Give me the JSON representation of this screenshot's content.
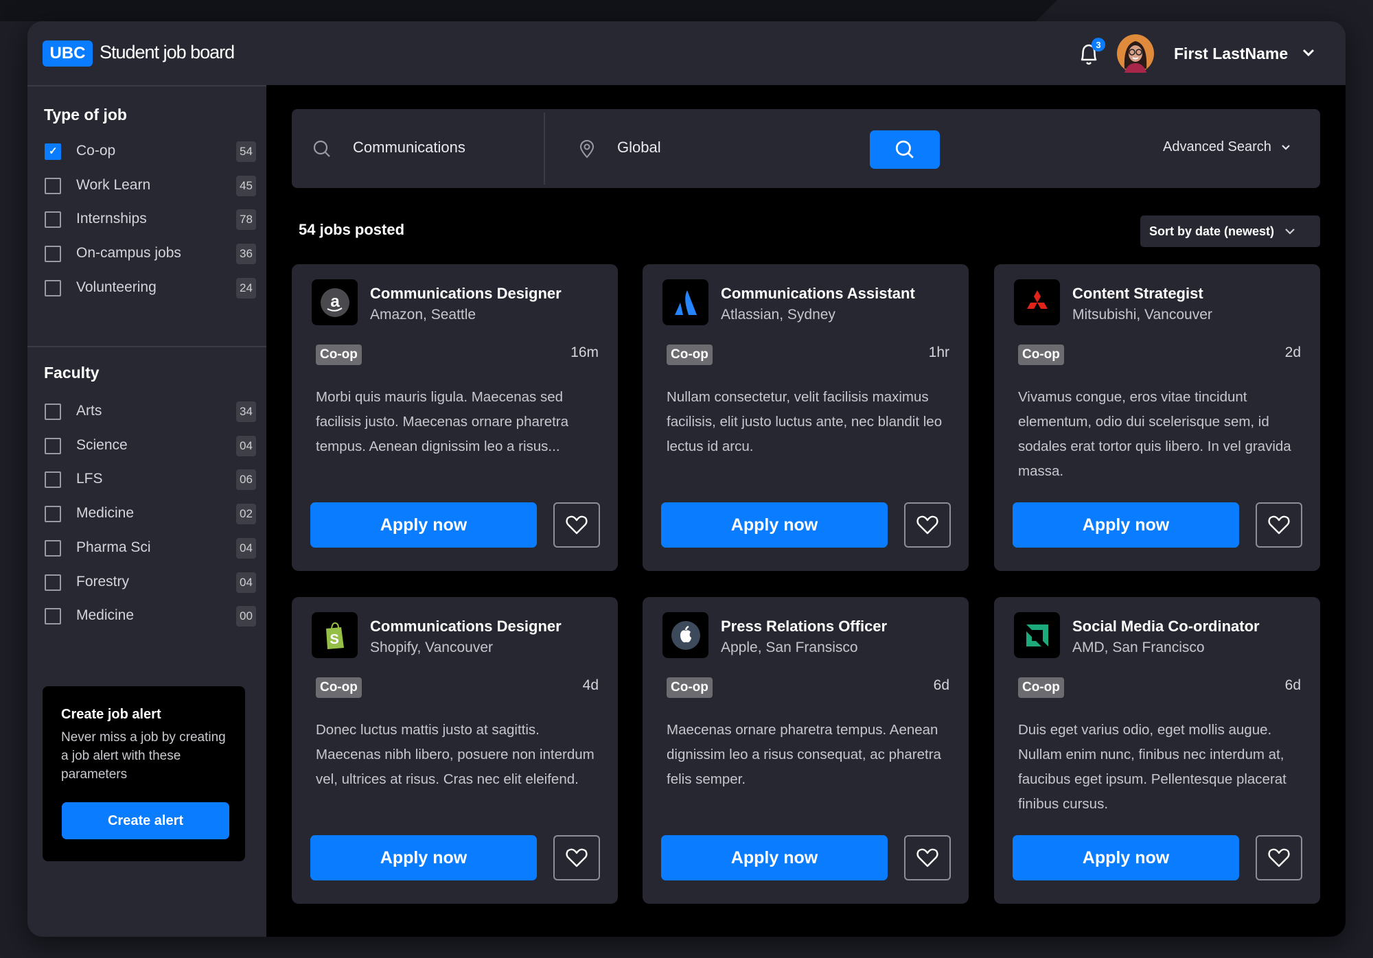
{
  "header": {
    "logo": "UBC",
    "title": "Student job board",
    "notifications": "3",
    "user_name": "First LastName"
  },
  "sidebar": {
    "type_heading": "Type of job",
    "types": [
      {
        "label": "Co-op",
        "count": "54",
        "checked": true
      },
      {
        "label": "Work Learn",
        "count": "45",
        "checked": false
      },
      {
        "label": "Internships",
        "count": "78",
        "checked": false
      },
      {
        "label": "On-campus jobs",
        "count": "36",
        "checked": false
      },
      {
        "label": "Volunteering",
        "count": "24",
        "checked": false
      }
    ],
    "faculty_heading": "Faculty",
    "faculties": [
      {
        "label": "Arts",
        "count": "34",
        "checked": false
      },
      {
        "label": "Science",
        "count": "04",
        "checked": false
      },
      {
        "label": "LFS",
        "count": "06",
        "checked": false
      },
      {
        "label": "Medicine",
        "count": "02",
        "checked": false
      },
      {
        "label": "Pharma Sci",
        "count": "04",
        "checked": false
      },
      {
        "label": "Forestry",
        "count": "04",
        "checked": false
      },
      {
        "label": "Medicine",
        "count": "00",
        "checked": false
      }
    ],
    "alert": {
      "title": "Create job alert",
      "text": "Never miss a job by creating a job alert with these parameters",
      "button": "Create alert"
    }
  },
  "search": {
    "query": "Communications",
    "location": "Global",
    "advanced": "Advanced Search"
  },
  "results": {
    "count_label": "54 jobs posted",
    "sort": "Sort by date (newest)"
  },
  "colors": {
    "accent": "#0a7cff",
    "background": "#000000",
    "panel": "#272831"
  },
  "jobs": [
    {
      "title": "Communications Designer",
      "company": "Amazon, Seattle",
      "type": "Co-op",
      "time": "16m",
      "desc": "Morbi quis mauris ligula. Maecenas sed facilisis justo. Maecenas ornare pharetra tempus. Aenean dignissim leo a risus...",
      "logo": "amazon",
      "apply": "Apply now"
    },
    {
      "title": "Communications Assistant",
      "company": "Atlassian, Sydney",
      "type": "Co-op",
      "time": "1hr",
      "desc": "Nullam consectetur, velit facilisis maximus facilisis, elit justo luctus ante, nec blandit leo lectus id arcu.",
      "logo": "atlassian",
      "apply": "Apply now"
    },
    {
      "title": "Content Strategist",
      "company": "Mitsubishi, Vancouver",
      "type": "Co-op",
      "time": "2d",
      "desc": "Vivamus congue, eros vitae tincidunt elementum, odio dui scelerisque sem, id sodales erat tortor quis libero. In vel gravida massa.",
      "logo": "mitsubishi",
      "apply": "Apply now"
    },
    {
      "title": "Communications Designer",
      "company": "Shopify, Vancouver",
      "type": "Co-op",
      "time": "4d",
      "desc": "Donec luctus mattis justo at sagittis. Maecenas nibh libero, posuere non interdum vel, ultrices at risus. Cras nec elit eleifend.",
      "logo": "shopify",
      "apply": "Apply now"
    },
    {
      "title": "Press Relations Officer",
      "company": "Apple, San Fransisco",
      "type": "Co-op",
      "time": "6d",
      "desc": "Maecenas ornare pharetra tempus. Aenean dignissim leo a risus consequat, ac pharetra felis semper.",
      "logo": "apple",
      "apply": "Apply now"
    },
    {
      "title": "Social Media Co-ordinator",
      "company": "AMD, San Francisco",
      "type": "Co-op",
      "time": "6d",
      "desc": "Duis eget varius odio, eget mollis augue. Nullam enim nunc, finibus nec interdum at, faucibus eget ipsum. Pellentesque placerat finibus cursus.",
      "logo": "amd",
      "apply": "Apply now"
    }
  ]
}
